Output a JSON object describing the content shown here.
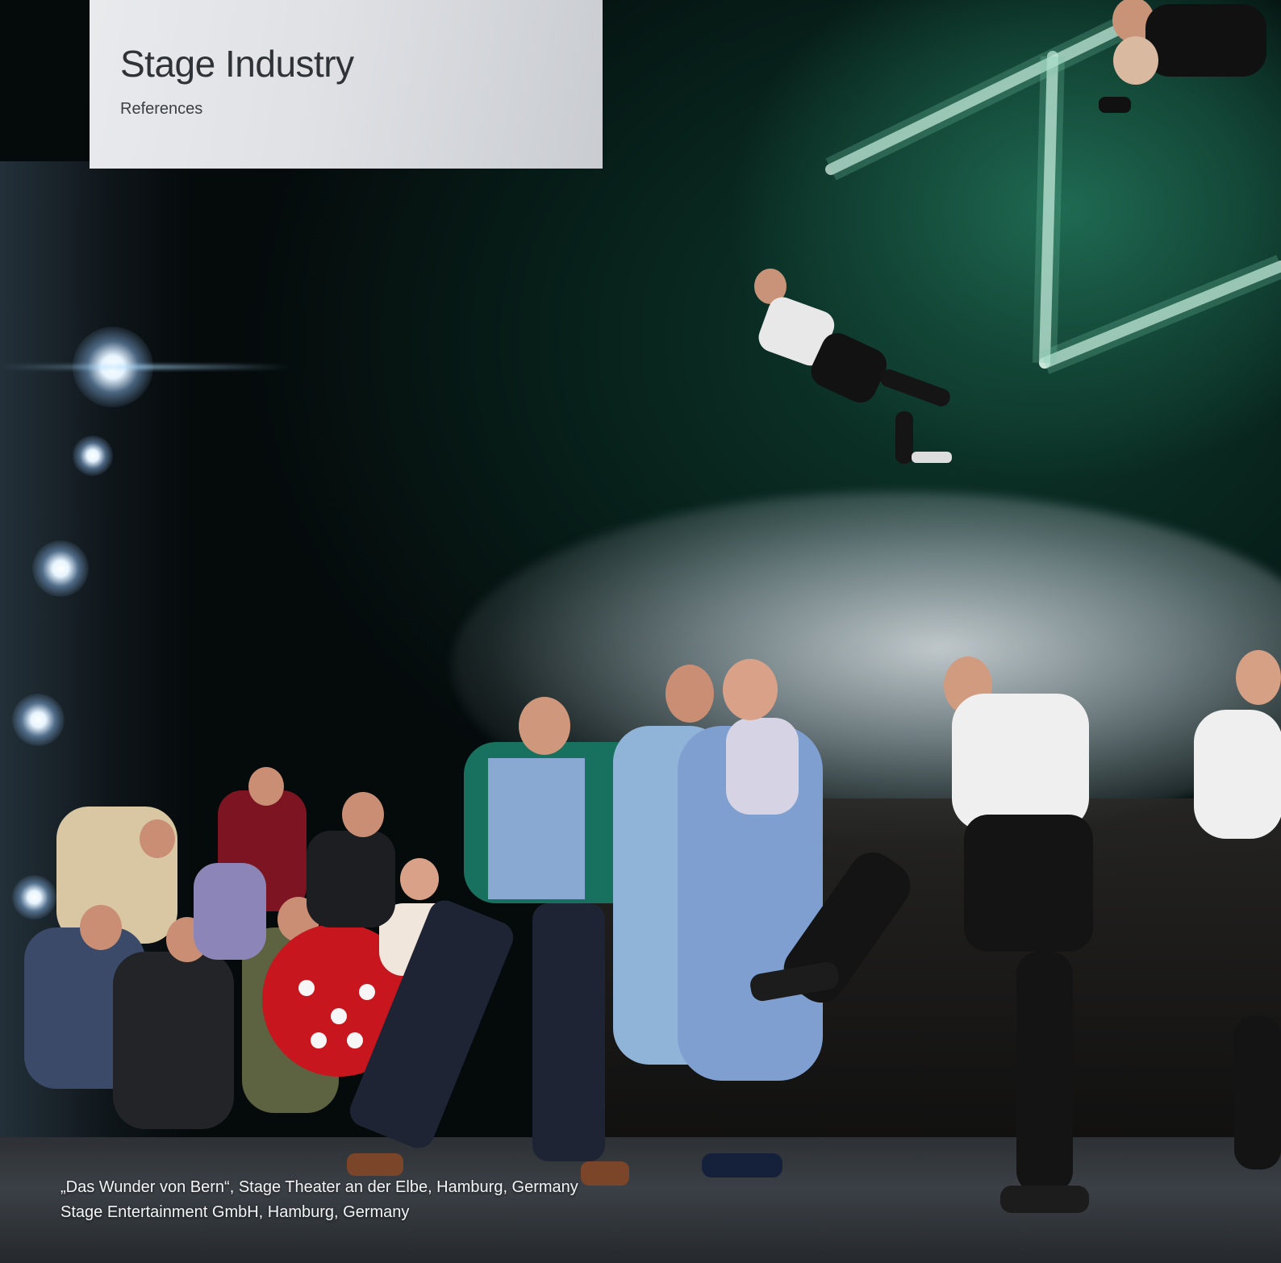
{
  "header": {
    "title": "Stage Industry",
    "subtitle": "References"
  },
  "photo": {
    "caption_line_1": "„Das Wunder von Bern“, Stage Theater an der Elbe, Hamburg, Germany",
    "caption_line_2": "Stage Entertainment GmbH, Hamburg, Germany"
  },
  "colors": {
    "header_card": "#dfe1e5",
    "title_text": "#2f3338",
    "caption_text": "#f2f4f6",
    "pitch_green": "#134636"
  }
}
